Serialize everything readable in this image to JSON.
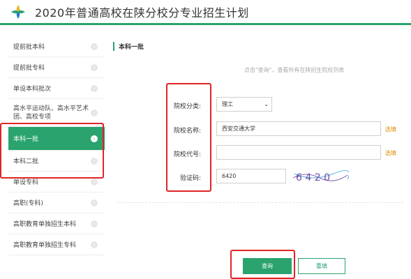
{
  "header": {
    "title": "2020年普通高校在陕分校分专业招生计划",
    "accent_color": "#2aa36e",
    "logo_icon": "leaf-logo-icon"
  },
  "sidebar": {
    "items": [
      {
        "label": "提前批本科"
      },
      {
        "label": "提前批专科"
      },
      {
        "label": "单设本科批次"
      },
      {
        "label": "高水平运动队、高水平艺术团、高校专项"
      },
      {
        "label": "本科一批",
        "active": true
      },
      {
        "label": "本科二批"
      },
      {
        "label": "单设专科"
      },
      {
        "label": "高职(专科)"
      },
      {
        "label": "高职教育单独招生本科"
      },
      {
        "label": "高职教育单独招生专科"
      }
    ],
    "arrow_icon": "chevron-right-circle-icon",
    "active_color": "#2aa36e"
  },
  "main": {
    "section_title": "本科一批",
    "hint": "点击\"查询\"，查看所有在陕招生院校列表",
    "form": {
      "category_label": "院校分类:",
      "category_value": "理工",
      "name_label": "院校名称:",
      "name_value": "西安交通大学",
      "code_label": "院校代号:",
      "code_value": "",
      "captcha_label": "验证码:",
      "captcha_value": "6420",
      "captcha_image_text": "6 4 2 0",
      "optional_text": "选填"
    },
    "buttons": {
      "query": "查询",
      "reset": "重填"
    }
  },
  "highlight_color": "#e02424"
}
